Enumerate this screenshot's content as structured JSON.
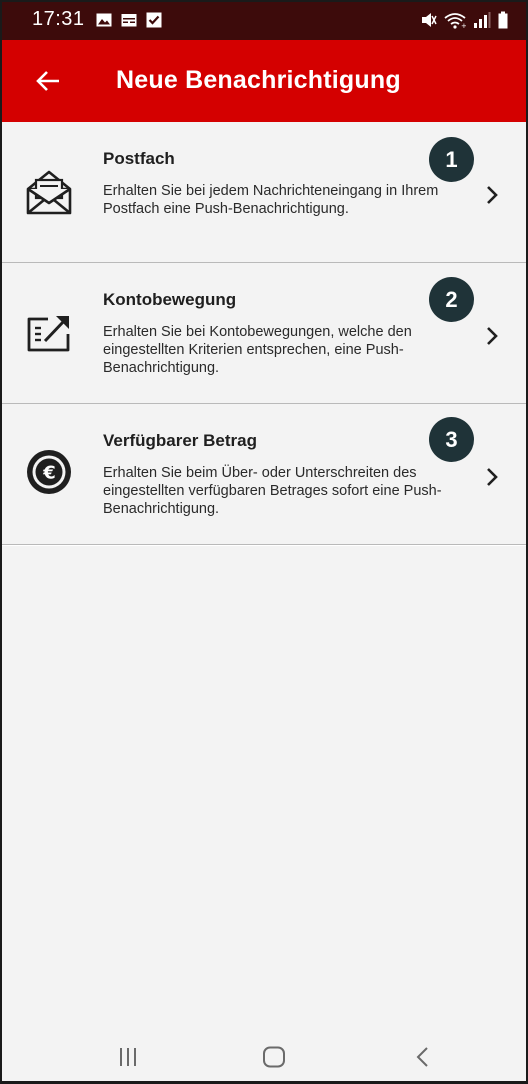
{
  "status_bar": {
    "time": "17:31",
    "left_icons": [
      "image-icon",
      "calendar-icon",
      "checkbox-icon"
    ],
    "right_icons": [
      "mute-icon",
      "wifi-icon",
      "signal-icon",
      "battery-icon"
    ]
  },
  "app_bar": {
    "back_icon": "arrow-left-icon",
    "title": "Neue Benachrichtigung"
  },
  "items": [
    {
      "icon": "open-envelope-icon",
      "title": "Postfach",
      "description": "Erhalten Sie bei jedem Nachrichteneingang in Ihrem Postfach eine Push-Benachrichtigung.",
      "badge": "1"
    },
    {
      "icon": "account-movement-icon",
      "title": "Kontobewegung",
      "description": "Erhalten Sie bei Kontobewegungen, welche den eingestellten Kriterien entsprechen, eine Push-Benachrichtigung.",
      "badge": "2"
    },
    {
      "icon": "euro-coin-icon",
      "title": "Verfügbarer Betrag",
      "description": "Erhalten Sie beim Über- oder Unterschreiten des eingestellten verfügbaren Betrages sofort eine Push-Benachrichtigung.",
      "badge": "3"
    }
  ],
  "nav_bar": {
    "buttons": [
      "recent-apps-icon",
      "home-icon",
      "back-icon"
    ]
  },
  "colors": {
    "status_bar": "#3d0b0b",
    "app_bar": "#d40000",
    "badge": "#1f3338",
    "list_background": "#f3f3f3"
  }
}
